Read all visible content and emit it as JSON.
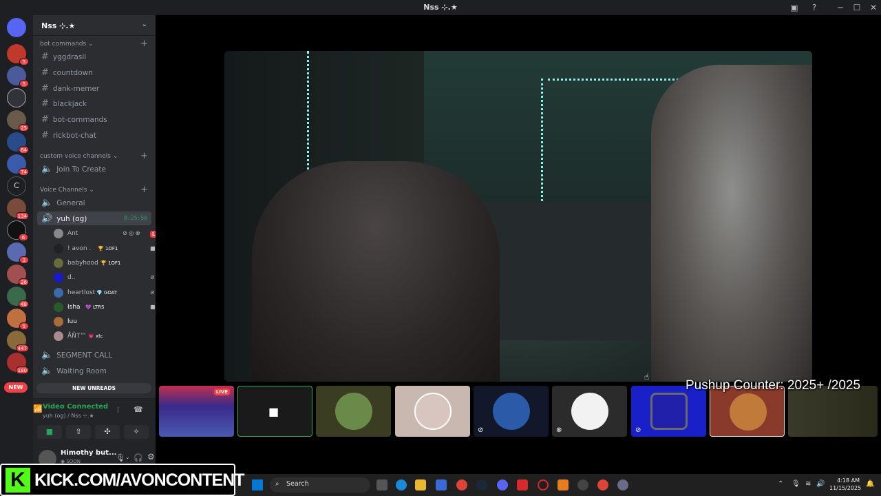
{
  "window": {
    "title": "Nss ⊹.★"
  },
  "server": {
    "name": "Nss ⊹.★"
  },
  "categories": {
    "bot_commands": "bot commands",
    "custom_voice": "custom voice channels",
    "voice": "Voice Channels"
  },
  "text_channels": [
    "yggdrasil",
    "countdown",
    "dank-memer",
    "blackjack",
    "bot-commands",
    "rickbot-chat"
  ],
  "custom_voice_channels": [
    "Join To Create"
  ],
  "voice_channels": {
    "general": "General",
    "active": "yuh (og)",
    "active_timer": "8:25:50",
    "segment_call": "SEGMENT CALL",
    "waiting_room": "Waiting Room"
  },
  "voice_users": [
    {
      "name": "Ant",
      "tag": "",
      "live": "LIVE"
    },
    {
      "name": "! avon .",
      "tag": "🏆 1OF1"
    },
    {
      "name": "babyhood",
      "tag": "🏆 1OF1"
    },
    {
      "name": "d..",
      "tag": ""
    },
    {
      "name": "heartlost",
      "tag": "💎 GOAT"
    },
    {
      "name": "Isha",
      "tag": "💜 LTRS"
    },
    {
      "name": "luu",
      "tag": ""
    },
    {
      "name": "ÅÑΤ™",
      "tag": "💗 xtc"
    }
  ],
  "guild_badges": [
    "5",
    "5",
    "25",
    "84",
    "74",
    "134",
    "6",
    "3",
    "26",
    "48",
    "5",
    "447",
    "180"
  ],
  "guild_new": "NEW",
  "new_unreads": "NEW UNREADS",
  "voice_panel": {
    "status": "Video Connected",
    "location": "yuh (og) / Nss ⊹.★"
  },
  "user_panel": {
    "name": "Himothy but...",
    "status": "SOON"
  },
  "tile_live": "LIVE",
  "overlay": {
    "pushup": "Pushup Counter: 2025+ /2025",
    "kick_logo": "K",
    "kick_url": "KICK.COM/AVONCONTENT"
  },
  "taskbar": {
    "search_placeholder": "Search",
    "time": "4:18 AM",
    "date": "11/15/2025"
  }
}
